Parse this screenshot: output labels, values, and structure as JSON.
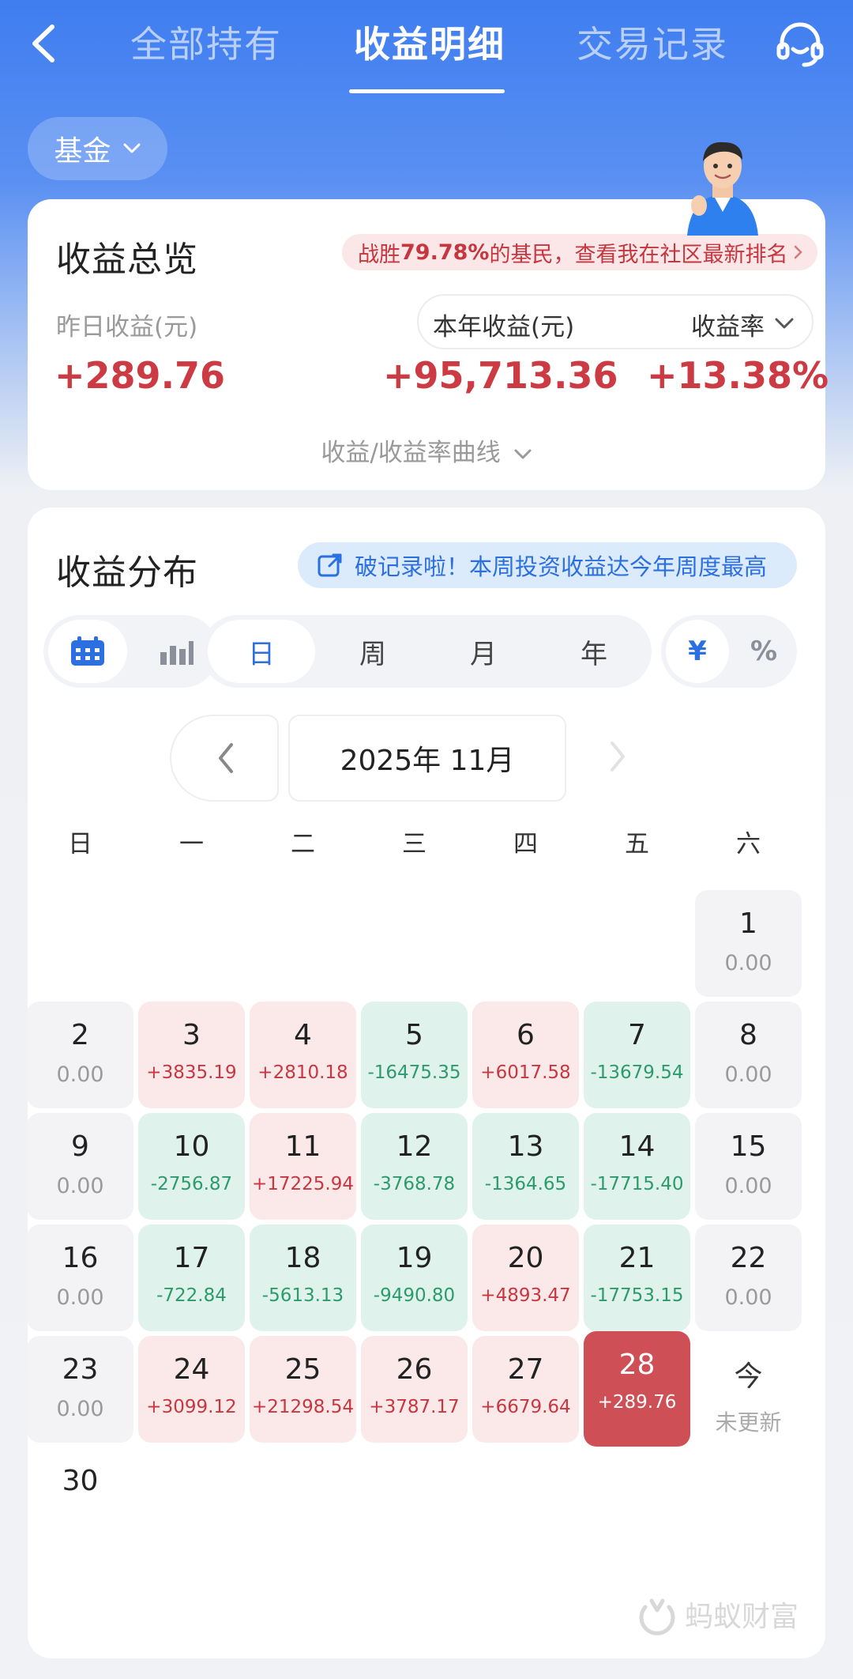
{
  "nav": {
    "tabs": [
      "全部持有",
      "收益明细",
      "交易记录"
    ],
    "active_tab": "收益明细"
  },
  "filter": {
    "label": "基金"
  },
  "overview": {
    "title": "收益总览",
    "rank_prefix": "战胜",
    "rank_pct": "79.78%",
    "rank_suffix": "的基民，查看我在社区最新排名",
    "yesterday_label": "昨日收益(元)",
    "yesterday_value": "+289.76",
    "year_label": "本年收益(元)",
    "year_value": "+95,713.36",
    "rate_label": "收益率",
    "rate_value": "+13.38%",
    "curve_toggle": "收益/收益率曲线"
  },
  "distribution": {
    "title": "收益分布",
    "record_text": "破记录啦！本周投资收益达今年周度最高",
    "period_tabs": [
      "日",
      "周",
      "月",
      "年"
    ],
    "active_period": "日",
    "unit_tabs": [
      "¥",
      "%"
    ],
    "active_unit": "¥",
    "month_label": "2025年 11月",
    "weekdays": [
      "日",
      "一",
      "二",
      "三",
      "四",
      "五",
      "六"
    ]
  },
  "calendar": [
    {
      "day": "1",
      "value": "0.00",
      "kind": "neutral"
    },
    {
      "day": "2",
      "value": "0.00",
      "kind": "neutral"
    },
    {
      "day": "3",
      "value": "+3835.19",
      "kind": "gain"
    },
    {
      "day": "4",
      "value": "+2810.18",
      "kind": "gain"
    },
    {
      "day": "5",
      "value": "-16475.35",
      "kind": "loss"
    },
    {
      "day": "6",
      "value": "+6017.58",
      "kind": "gain"
    },
    {
      "day": "7",
      "value": "-13679.54",
      "kind": "loss"
    },
    {
      "day": "8",
      "value": "0.00",
      "kind": "neutral"
    },
    {
      "day": "9",
      "value": "0.00",
      "kind": "neutral"
    },
    {
      "day": "10",
      "value": "-2756.87",
      "kind": "loss"
    },
    {
      "day": "11",
      "value": "+17225.94",
      "kind": "gain"
    },
    {
      "day": "12",
      "value": "-3768.78",
      "kind": "loss"
    },
    {
      "day": "13",
      "value": "-1364.65",
      "kind": "loss"
    },
    {
      "day": "14",
      "value": "-17715.40",
      "kind": "loss"
    },
    {
      "day": "15",
      "value": "0.00",
      "kind": "neutral"
    },
    {
      "day": "16",
      "value": "0.00",
      "kind": "neutral"
    },
    {
      "day": "17",
      "value": "-722.84",
      "kind": "loss"
    },
    {
      "day": "18",
      "value": "-5613.13",
      "kind": "loss"
    },
    {
      "day": "19",
      "value": "-9490.80",
      "kind": "loss"
    },
    {
      "day": "20",
      "value": "+4893.47",
      "kind": "gain"
    },
    {
      "day": "21",
      "value": "-17753.15",
      "kind": "loss"
    },
    {
      "day": "22",
      "value": "0.00",
      "kind": "neutral"
    },
    {
      "day": "23",
      "value": "0.00",
      "kind": "neutral"
    },
    {
      "day": "24",
      "value": "+3099.12",
      "kind": "gain"
    },
    {
      "day": "25",
      "value": "+21298.54",
      "kind": "gain"
    },
    {
      "day": "26",
      "value": "+3787.17",
      "kind": "gain"
    },
    {
      "day": "27",
      "value": "+6679.64",
      "kind": "gain"
    },
    {
      "day": "28",
      "value": "+289.76",
      "kind": "today"
    },
    {
      "day": "今",
      "value": "未更新",
      "kind": "pending"
    },
    {
      "day": "30",
      "value": "",
      "kind": "plain"
    }
  ],
  "watermark": {
    "text": "蚂蚁财富"
  },
  "colors": {
    "brand_blue": "#3f7df0",
    "gain_red": "#c8363f",
    "loss_green": "#2d9a6d",
    "today_bg": "#cf4f56"
  }
}
